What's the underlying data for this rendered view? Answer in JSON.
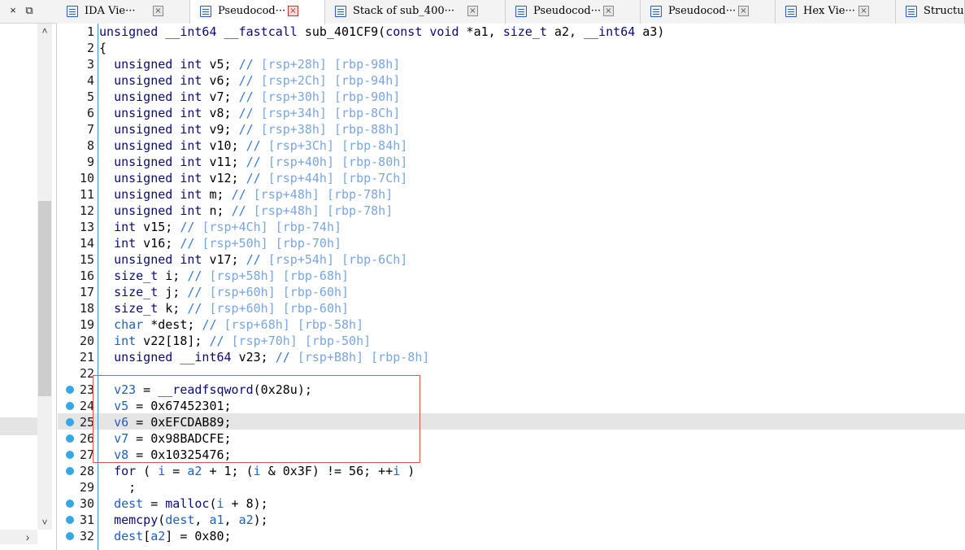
{
  "left_panel": {
    "close_glyph": "×",
    "restore_glyph": "⧉",
    "scroll_up": "˄",
    "scroll_down": "˅",
    "scroll_right": "›"
  },
  "tabs": [
    {
      "label": "IDA Vie···",
      "icon": "ida-view-icon",
      "close": "×",
      "active": false
    },
    {
      "label": "Pseudocod···",
      "icon": "pseudocode-icon",
      "close": "×",
      "active": true
    },
    {
      "label": "Stack of sub_400···",
      "icon": "stack-icon",
      "close": "×",
      "active": false
    },
    {
      "label": "Pseudocod···",
      "icon": "pseudocode-icon",
      "close": "×",
      "active": false
    },
    {
      "label": "Pseudocod···",
      "icon": "pseudocode-icon",
      "close": "×",
      "active": false
    },
    {
      "label": "Hex Vie···",
      "icon": "hex-view-icon",
      "close": "×",
      "active": false
    },
    {
      "label": "Structu",
      "icon": "structures-icon",
      "close": "",
      "active": false
    }
  ],
  "code": {
    "current_line": 25,
    "breakpoint_color": "#36a7e6",
    "lines": [
      {
        "n": "1",
        "bp": false,
        "html": "<span class=\"kw\">unsigned __int64 __fastcall</span> sub_401CF9(<span class=\"kw\">const void</span> *a1, <span class=\"kw\">size_t</span> a2, <span class=\"kw\">__int64</span> a3)"
      },
      {
        "n": "2",
        "bp": false,
        "html": "{"
      },
      {
        "n": "3",
        "bp": false,
        "html": "  <span class=\"kw\">unsigned int</span> v5; <span class=\"cm\">//</span> <span class=\"addr\">[rsp+28h] [rbp-98h]</span>"
      },
      {
        "n": "4",
        "bp": false,
        "html": "  <span class=\"kw\">unsigned int</span> v6; <span class=\"cm\">//</span> <span class=\"addr\">[rsp+2Ch] [rbp-94h]</span>"
      },
      {
        "n": "5",
        "bp": false,
        "html": "  <span class=\"kw\">unsigned int</span> v7; <span class=\"cm\">//</span> <span class=\"addr\">[rsp+30h] [rbp-90h]</span>"
      },
      {
        "n": "6",
        "bp": false,
        "html": "  <span class=\"kw\">unsigned int</span> v8; <span class=\"cm\">//</span> <span class=\"addr\">[rsp+34h] [rbp-8Ch]</span>"
      },
      {
        "n": "7",
        "bp": false,
        "html": "  <span class=\"kw\">unsigned int</span> v9; <span class=\"cm\">//</span> <span class=\"addr\">[rsp+38h] [rbp-88h]</span>"
      },
      {
        "n": "8",
        "bp": false,
        "html": "  <span class=\"kw\">unsigned int</span> v10; <span class=\"cm\">//</span> <span class=\"addr\">[rsp+3Ch] [rbp-84h]</span>"
      },
      {
        "n": "9",
        "bp": false,
        "html": "  <span class=\"kw\">unsigned int</span> v11; <span class=\"cm\">//</span> <span class=\"addr\">[rsp+40h] [rbp-80h]</span>"
      },
      {
        "n": "10",
        "bp": false,
        "html": "  <span class=\"kw\">unsigned int</span> v12; <span class=\"cm\">//</span> <span class=\"addr\">[rsp+44h] [rbp-7Ch]</span>"
      },
      {
        "n": "11",
        "bp": false,
        "html": "  <span class=\"kw\">unsigned int</span> m; <span class=\"cm\">//</span> <span class=\"addr\">[rsp+48h] [rbp-78h]</span>"
      },
      {
        "n": "12",
        "bp": false,
        "html": "  <span class=\"kw\">unsigned int</span> n; <span class=\"cm\">//</span> <span class=\"addr\">[rsp+48h] [rbp-78h]</span>"
      },
      {
        "n": "13",
        "bp": false,
        "html": "  <span class=\"kw\">int</span> v15; <span class=\"cm\">//</span> <span class=\"addr\">[rsp+4Ch] [rbp-74h]</span>"
      },
      {
        "n": "14",
        "bp": false,
        "html": "  <span class=\"kw\">int</span> v16; <span class=\"cm\">//</span> <span class=\"addr\">[rsp+50h] [rbp-70h]</span>"
      },
      {
        "n": "15",
        "bp": false,
        "html": "  <span class=\"kw\">unsigned int</span> v17; <span class=\"cm\">//</span> <span class=\"addr\">[rsp+54h] [rbp-6Ch]</span>"
      },
      {
        "n": "16",
        "bp": false,
        "html": "  <span class=\"kw\">size_t</span> i; <span class=\"cm\">//</span> <span class=\"addr\">[rsp+58h] [rbp-68h]</span>"
      },
      {
        "n": "17",
        "bp": false,
        "html": "  <span class=\"kw\">size_t</span> j; <span class=\"cm\">//</span> <span class=\"addr\">[rsp+60h] [rbp-60h]</span>"
      },
      {
        "n": "18",
        "bp": false,
        "html": "  <span class=\"kw\">size_t</span> k; <span class=\"cm\">//</span> <span class=\"addr\">[rsp+60h] [rbp-60h]</span>"
      },
      {
        "n": "19",
        "bp": false,
        "html": "  <span class=\"var\">char</span> *dest; <span class=\"cm\">//</span> <span class=\"addr\">[rsp+68h] [rbp-58h]</span>"
      },
      {
        "n": "20",
        "bp": false,
        "html": "  <span class=\"var\">int</span> v22[18]; <span class=\"cm\">//</span> <span class=\"addr\">[rsp+70h] [rbp-50h]</span>"
      },
      {
        "n": "21",
        "bp": false,
        "html": "  <span class=\"kw\">unsigned __int64</span> v23; <span class=\"cm\">//</span> <span class=\"addr\">[rsp+B8h] [rbp-8h]</span>"
      },
      {
        "n": "22",
        "bp": false,
        "html": ""
      },
      {
        "n": "23",
        "bp": true,
        "html": "  <span class=\"var\">v23</span> = <span class=\"fn\">__readfsqword</span>(0x28u);"
      },
      {
        "n": "24",
        "bp": true,
        "html": "  <span class=\"var\">v5</span> = 0x67452301;"
      },
      {
        "n": "25",
        "bp": true,
        "html": "  <span class=\"var\">v6</span> = 0xEFCDAB89;"
      },
      {
        "n": "26",
        "bp": true,
        "html": "  <span class=\"var\">v7</span> = 0x98BADCFE;"
      },
      {
        "n": "27",
        "bp": true,
        "html": "  <span class=\"var\">v8</span> = 0x10325476;"
      },
      {
        "n": "28",
        "bp": true,
        "html": "  <span class=\"kw\">for</span> ( <span class=\"var\">i</span> = <span class=\"var\">a2</span> + 1; (<span class=\"var\">i</span> &amp; 0x3F) != 56; ++<span class=\"var\">i</span> )"
      },
      {
        "n": "29",
        "bp": false,
        "html": "    ;"
      },
      {
        "n": "30",
        "bp": true,
        "html": "  <span class=\"var\">dest</span> = <span class=\"fn\">malloc</span>(<span class=\"var\">i</span> + 8);"
      },
      {
        "n": "31",
        "bp": true,
        "html": "  <span class=\"fn\">memcpy</span>(<span class=\"var\">dest</span>, <span class=\"var\">a1</span>, <span class=\"var\">a2</span>);"
      },
      {
        "n": "32",
        "bp": true,
        "html": "  <span class=\"var\">dest</span>[<span class=\"var\">a2</span>] = 0x80;"
      }
    ]
  }
}
